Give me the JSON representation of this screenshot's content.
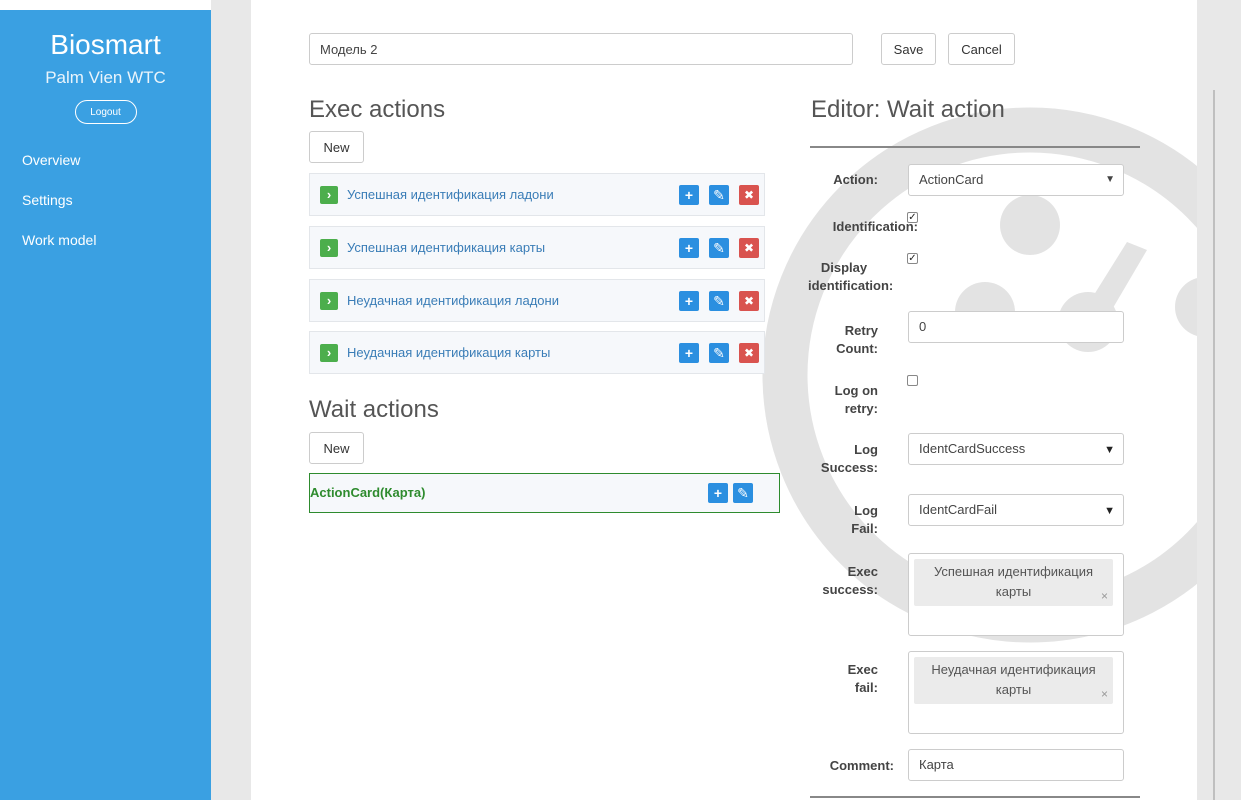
{
  "sidebar": {
    "brand": "Biosmart",
    "subtitle": "Palm Vien WTC",
    "logout": "Logout",
    "nav": [
      {
        "label": "Overview"
      },
      {
        "label": "Settings"
      },
      {
        "label": "Work model"
      }
    ]
  },
  "header": {
    "model_name": "Модель 2",
    "save": "Save",
    "cancel": "Cancel"
  },
  "exec_actions": {
    "title": "Exec actions",
    "new_label": "New",
    "items": [
      {
        "label": "Успешная идентификация ладони"
      },
      {
        "label": "Успешная идентификация карты"
      },
      {
        "label": "Неудачная идентификация ладони"
      },
      {
        "label": "Неудачная идентификация карты"
      }
    ]
  },
  "wait_actions": {
    "title": "Wait actions",
    "new_label": "New",
    "items": [
      {
        "label": "ActionCard(Карта)"
      }
    ]
  },
  "editor": {
    "title": "Editor: Wait action",
    "action_label": "Action:",
    "action_value": "ActionCard",
    "identification_label": "Identification:",
    "identification_checked": true,
    "display_identification_label_1": "Display",
    "display_identification_label_2": "identification:",
    "display_identification_checked": true,
    "retry_count_label_1": "Retry",
    "retry_count_label_2": "Count:",
    "retry_count_value": "0",
    "log_on_retry_label_1": "Log on",
    "log_on_retry_label_2": "retry:",
    "log_on_retry_checked": false,
    "log_success_label_1": "Log",
    "log_success_label_2": "Success:",
    "log_success_value": "IdentCardSuccess",
    "log_fail_label_1": "Log",
    "log_fail_label_2": "Fail:",
    "log_fail_value": "IdentCardFail",
    "exec_success_label_1": "Exec",
    "exec_success_label_2": "success:",
    "exec_success_tag_line1": "Успешная идентификация",
    "exec_success_tag_line2": "карты",
    "exec_fail_label_1": "Exec",
    "exec_fail_label_2": "fail:",
    "exec_fail_tag_line1": "Неудачная идентификация",
    "exec_fail_tag_line2": "карты",
    "comment_label": "Comment:",
    "comment_value": "Карта"
  },
  "icons": {
    "add": "plus-icon",
    "edit": "edit-icon",
    "delete": "close-icon",
    "row": "chevron-right-icon"
  },
  "colors": {
    "sidebar": "#3aa0e2",
    "success": "#4cae4c",
    "primary": "#2b8fe0",
    "danger": "#d9534f",
    "link": "#3a7db7",
    "wait_active": "#2e8b2e"
  }
}
